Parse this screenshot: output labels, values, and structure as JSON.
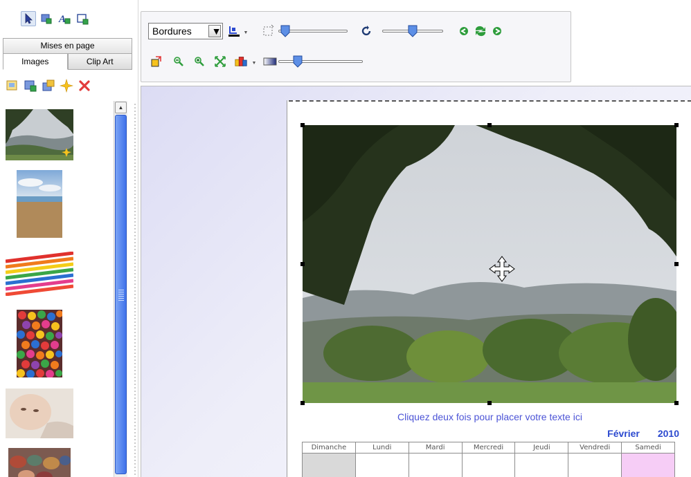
{
  "left_panel": {
    "mode_icons": [
      "select-arrow-icon",
      "image-tool-icon",
      "text-tool-icon",
      "frame-tool-icon"
    ],
    "tab_top": "Mises en page",
    "tabs": [
      {
        "label": "Images",
        "selected": true
      },
      {
        "label": "Clip Art",
        "selected": false
      }
    ],
    "toolbar_icons": [
      "open-folder-icon",
      "add-image-icon",
      "replace-image-icon",
      "effect-star-icon",
      "delete-icon"
    ],
    "thumbnails": [
      "forest-mountain-thumbnail",
      "beach-sky-thumbnail",
      "colored-pencils-thumbnail",
      "candies-thumbnail",
      "baby-face-thumbnail",
      "pebbles-thumbnail"
    ]
  },
  "toolbar": {
    "border_select": "Bordures",
    "colors": {
      "accent_blue": "#2b49cf",
      "arrow_green": "#2e9d3c"
    }
  },
  "page": {
    "caption": "Cliquez deux fois pour placer votre texte ici",
    "month": "Février",
    "year": "2010",
    "days": [
      "Dimanche",
      "Lundi",
      "Mardi",
      "Mercredi",
      "Jeudi",
      "Vendredi",
      "Samedi"
    ]
  }
}
